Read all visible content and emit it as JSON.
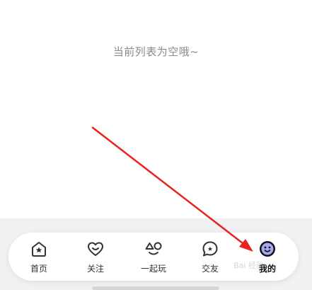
{
  "empty_state": {
    "message": "当前列表为空哦~"
  },
  "tabbar": {
    "items": [
      {
        "label": "首页",
        "icon": "home-icon"
      },
      {
        "label": "关注",
        "icon": "heart-smile-icon"
      },
      {
        "label": "一起玩",
        "icon": "play-shapes-icon"
      },
      {
        "label": "交友",
        "icon": "chat-bubble-icon"
      },
      {
        "label": "我的",
        "icon": "avatar-icon"
      }
    ],
    "active_index": 4
  },
  "annotation": {
    "arrow_color": "#e8231f"
  },
  "watermark": {
    "text": "Bai 经验"
  }
}
